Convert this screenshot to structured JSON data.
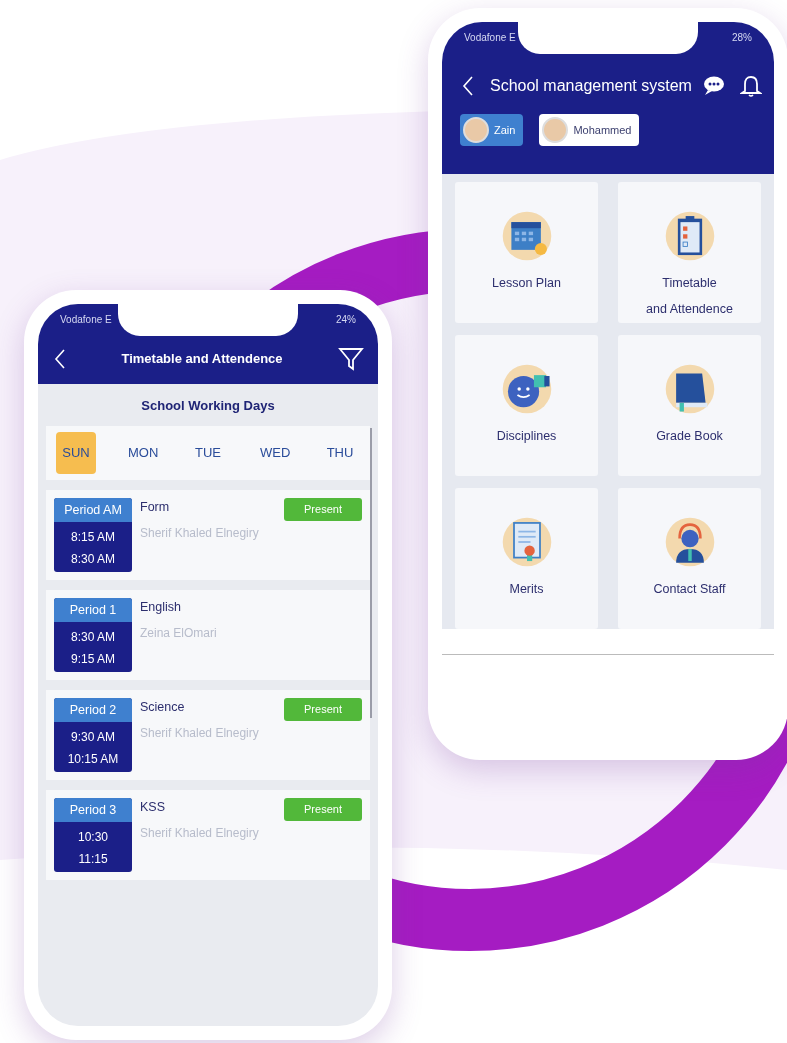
{
  "phone_right": {
    "status": {
      "carrier": "Vodafone E",
      "battery": "28%"
    },
    "title": "School management system",
    "students": [
      {
        "name": "Zain",
        "selected": true
      },
      {
        "name": "Mohammed",
        "selected": false
      }
    ],
    "tiles": [
      {
        "label": "Lesson Plan"
      },
      {
        "label": "Timetable\nand Attendence"
      },
      {
        "label": "Disciplines"
      },
      {
        "label": "Grade Book"
      },
      {
        "label": "Merits"
      },
      {
        "label": "Contact Staff"
      }
    ]
  },
  "phone_left": {
    "status": {
      "carrier": "Vodafone E",
      "battery": "24%"
    },
    "title": "Timetable and Attendence",
    "section_title": "School Working Days",
    "days": [
      {
        "label": "SUN",
        "selected": true
      },
      {
        "label": "MON",
        "selected": false
      },
      {
        "label": "TUE",
        "selected": false
      },
      {
        "label": "WED",
        "selected": false
      },
      {
        "label": "THU",
        "selected": false
      }
    ],
    "periods": [
      {
        "period": "Period AM",
        "start": "8:15 AM",
        "end": "8:30 AM",
        "subject": "Form",
        "teacher": "Sherif Khaled Elnegiry",
        "status": "Present"
      },
      {
        "period": "Period 1",
        "start": "8:30 AM",
        "end": "9:15 AM",
        "subject": "English",
        "teacher": "Zeina ElOmari"
      },
      {
        "period": "Period 2",
        "start": "9:30 AM",
        "end": "10:15 AM",
        "subject": "Science",
        "teacher": "Sherif Khaled Elnegiry",
        "status": "Present"
      },
      {
        "period": "Period 3",
        "start": "10:30",
        "end": "11:15",
        "subject": "KSS",
        "teacher": "Sherif Khaled Elnegiry",
        "status": "Present"
      }
    ]
  }
}
